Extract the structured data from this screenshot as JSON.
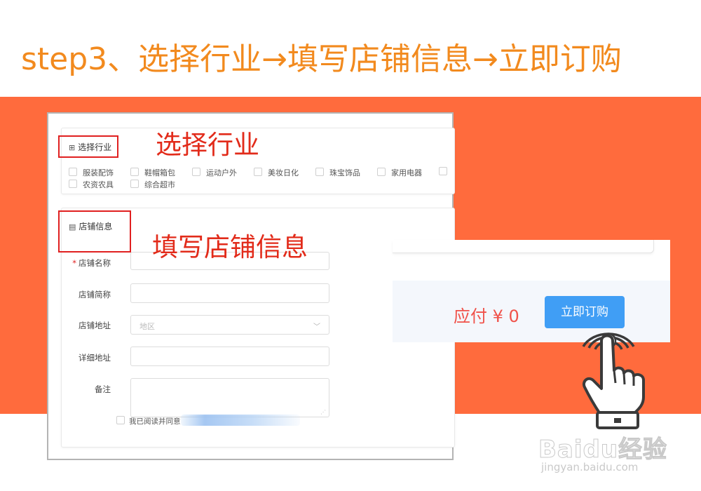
{
  "heading": "step3、选择行业→填写店铺信息→立即订购",
  "annotations": {
    "select_industry": "选择行业",
    "fill_store_info": "填写店铺信息"
  },
  "industry_section": {
    "icon": "grid-icon",
    "title": "选择行业",
    "row1": [
      "服装配饰",
      "鞋帽箱包",
      "运动户外",
      "美妆日化",
      "珠宝饰品",
      "家用电器"
    ],
    "row2": [
      "农资农具",
      "综合超市"
    ]
  },
  "store_section": {
    "icon": "store-icon",
    "title": "店铺信息",
    "fields": {
      "name_label": "店铺名称",
      "short_name_label": "店铺简称",
      "address_label": "店铺地址",
      "address_placeholder": "地区",
      "detail_address_label": "详细地址",
      "remark_label": "备注"
    },
    "required_mark": "*",
    "agree_text": "我已阅读并同意"
  },
  "order": {
    "amount_text": "应付 ¥ 0",
    "buy_button": "立即订购"
  },
  "watermark": {
    "logo": "Baidu经验",
    "url": "jingyan.baidu.com"
  },
  "colors": {
    "heading": "#f28a1e",
    "band": "#ff6b3d",
    "annotation": "#e22b1a",
    "highlight_box": "#e02020",
    "button": "#409ef5",
    "amount": "#f0524a"
  }
}
